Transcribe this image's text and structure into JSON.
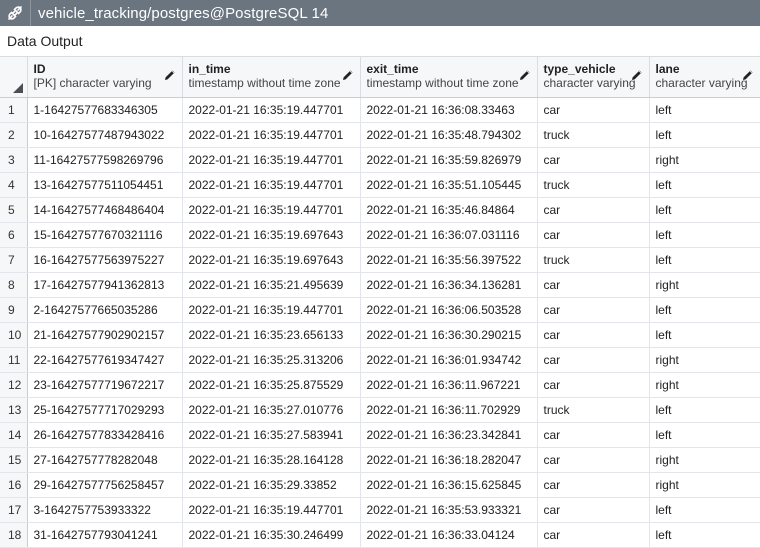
{
  "titlebar": {
    "icon": "plug-connection-icon",
    "title": "vehicle_tracking/postgres@PostgreSQL 14"
  },
  "panel": {
    "label": "Data Output"
  },
  "columns": [
    {
      "name": "ID",
      "type": "[PK] character varying"
    },
    {
      "name": "in_time",
      "type": "timestamp without time zone"
    },
    {
      "name": "exit_time",
      "type": "timestamp without time zone"
    },
    {
      "name": "type_vehicle",
      "type": "character varying"
    },
    {
      "name": "lane",
      "type": "character varying"
    }
  ],
  "rows": [
    {
      "n": "1",
      "id": "1-16427577683346305",
      "in_time": "2022-01-21 16:35:19.447701",
      "exit_time": "2022-01-21 16:36:08.33463",
      "type_vehicle": "car",
      "lane": "left"
    },
    {
      "n": "2",
      "id": "10-16427577487943022",
      "in_time": "2022-01-21 16:35:19.447701",
      "exit_time": "2022-01-21 16:35:48.794302",
      "type_vehicle": "truck",
      "lane": "left"
    },
    {
      "n": "3",
      "id": "11-16427577598269796",
      "in_time": "2022-01-21 16:35:19.447701",
      "exit_time": "2022-01-21 16:35:59.826979",
      "type_vehicle": "car",
      "lane": "right"
    },
    {
      "n": "4",
      "id": "13-16427577511054451",
      "in_time": "2022-01-21 16:35:19.447701",
      "exit_time": "2022-01-21 16:35:51.105445",
      "type_vehicle": "truck",
      "lane": "left"
    },
    {
      "n": "5",
      "id": "14-16427577468486404",
      "in_time": "2022-01-21 16:35:19.447701",
      "exit_time": "2022-01-21 16:35:46.84864",
      "type_vehicle": "car",
      "lane": "left"
    },
    {
      "n": "6",
      "id": "15-16427577670321116",
      "in_time": "2022-01-21 16:35:19.697643",
      "exit_time": "2022-01-21 16:36:07.031116",
      "type_vehicle": "car",
      "lane": "left"
    },
    {
      "n": "7",
      "id": "16-16427577563975227",
      "in_time": "2022-01-21 16:35:19.697643",
      "exit_time": "2022-01-21 16:35:56.397522",
      "type_vehicle": "truck",
      "lane": "left"
    },
    {
      "n": "8",
      "id": "17-16427577941362813",
      "in_time": "2022-01-21 16:35:21.495639",
      "exit_time": "2022-01-21 16:36:34.136281",
      "type_vehicle": "car",
      "lane": "right"
    },
    {
      "n": "9",
      "id": "2-16427577665035286",
      "in_time": "2022-01-21 16:35:19.447701",
      "exit_time": "2022-01-21 16:36:06.503528",
      "type_vehicle": "car",
      "lane": "left"
    },
    {
      "n": "10",
      "id": "21-16427577902902157",
      "in_time": "2022-01-21 16:35:23.656133",
      "exit_time": "2022-01-21 16:36:30.290215",
      "type_vehicle": "car",
      "lane": "left"
    },
    {
      "n": "11",
      "id": "22-16427577619347427",
      "in_time": "2022-01-21 16:35:25.313206",
      "exit_time": "2022-01-21 16:36:01.934742",
      "type_vehicle": "car",
      "lane": "right"
    },
    {
      "n": "12",
      "id": "23-16427577719672217",
      "in_time": "2022-01-21 16:35:25.875529",
      "exit_time": "2022-01-21 16:36:11.967221",
      "type_vehicle": "car",
      "lane": "right"
    },
    {
      "n": "13",
      "id": "25-16427577717029293",
      "in_time": "2022-01-21 16:35:27.010776",
      "exit_time": "2022-01-21 16:36:11.702929",
      "type_vehicle": "truck",
      "lane": "left"
    },
    {
      "n": "14",
      "id": "26-16427577833428416",
      "in_time": "2022-01-21 16:35:27.583941",
      "exit_time": "2022-01-21 16:36:23.342841",
      "type_vehicle": "car",
      "lane": "left"
    },
    {
      "n": "15",
      "id": "27-1642757778282048",
      "in_time": "2022-01-21 16:35:28.164128",
      "exit_time": "2022-01-21 16:36:18.282047",
      "type_vehicle": "car",
      "lane": "right"
    },
    {
      "n": "16",
      "id": "29-16427577756258457",
      "in_time": "2022-01-21 16:35:29.33852",
      "exit_time": "2022-01-21 16:36:15.625845",
      "type_vehicle": "car",
      "lane": "right"
    },
    {
      "n": "17",
      "id": "3-1642757753933322",
      "in_time": "2022-01-21 16:35:19.447701",
      "exit_time": "2022-01-21 16:35:53.933321",
      "type_vehicle": "car",
      "lane": "left"
    },
    {
      "n": "18",
      "id": "31-1642757793041241",
      "in_time": "2022-01-21 16:35:30.246499",
      "exit_time": "2022-01-21 16:36:33.04124",
      "type_vehicle": "car",
      "lane": "left"
    }
  ]
}
